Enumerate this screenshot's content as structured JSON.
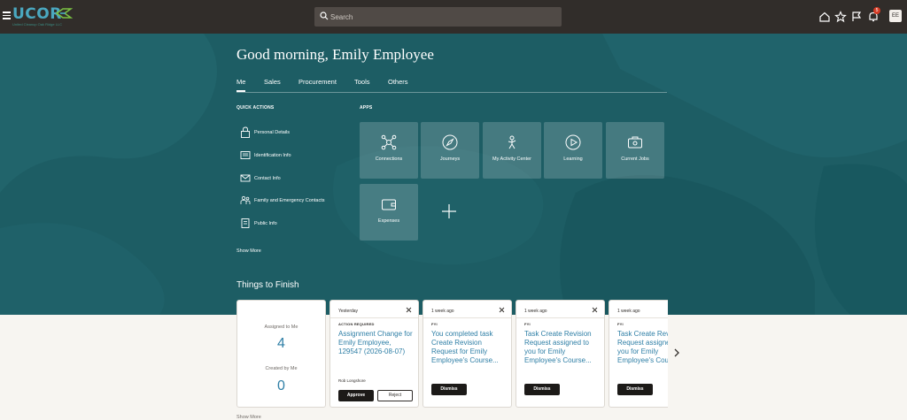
{
  "header": {
    "logo_text": "UCOR",
    "logo_subtitle": "United Cleanup Oak Ridge LLC",
    "search_placeholder": "Search",
    "notification_count": "5",
    "avatar_initials": "EE"
  },
  "hero": {
    "greeting": "Good morning, Emily Employee",
    "tabs": [
      {
        "label": "Me"
      },
      {
        "label": "Sales"
      },
      {
        "label": "Procurement"
      },
      {
        "label": "Tools"
      },
      {
        "label": "Others"
      }
    ],
    "quick_actions_label": "QUICK ACTIONS",
    "quick_actions": [
      {
        "label": "Personal Details",
        "icon": "lock-person-icon"
      },
      {
        "label": "Identification Info",
        "icon": "id-card-icon"
      },
      {
        "label": "Contact Info",
        "icon": "envelope-icon"
      },
      {
        "label": "Family and Emergency Contacts",
        "icon": "family-icon"
      },
      {
        "label": "Public Info",
        "icon": "document-icon"
      }
    ],
    "show_more": "Show More",
    "apps_label": "APPS",
    "apps": [
      {
        "label": "Connections",
        "icon": "network-icon"
      },
      {
        "label": "Journeys",
        "icon": "compass-icon"
      },
      {
        "label": "My Activity Center",
        "icon": "activity-icon"
      },
      {
        "label": "Learning",
        "icon": "play-circle-icon"
      },
      {
        "label": "Current Jobs",
        "icon": "briefcase-icon"
      },
      {
        "label": "Expenses",
        "icon": "wallet-icon"
      }
    ]
  },
  "things_to_finish": {
    "title": "Things to Finish",
    "assigned_label": "Assigned to Me",
    "assigned_count": "4",
    "created_label": "Created by Me",
    "created_count": "0",
    "cards": [
      {
        "time": "Yesterday",
        "tag": "ACTION REQUIRED",
        "title": "Assignment Change for Emily Employee, 129547 (2026-08-07)",
        "person": "Rob Longshore",
        "approve": "Approve",
        "reject": "Reject"
      },
      {
        "time": "1 week ago",
        "tag": "FYI",
        "title": "You completed task Create Revision Request for Emily Employee's Course...",
        "dismiss": "Dismiss"
      },
      {
        "time": "1 week ago",
        "tag": "FYI",
        "title": "Task Create Revision Request assigned to you for Emily Employee's Course...",
        "dismiss": "Dismiss"
      },
      {
        "time": "1 week ago",
        "tag": "FYI",
        "title": "Task Create Revision Request assigned to you for Emily Employee's Course...",
        "dismiss": "Dismiss"
      }
    ],
    "show_more": "Show More"
  },
  "colors": {
    "header_bg": "#312d2a",
    "hero_bg": "#1d5d64",
    "link_blue": "#2f7fa6",
    "badge_red": "#d63b25"
  }
}
